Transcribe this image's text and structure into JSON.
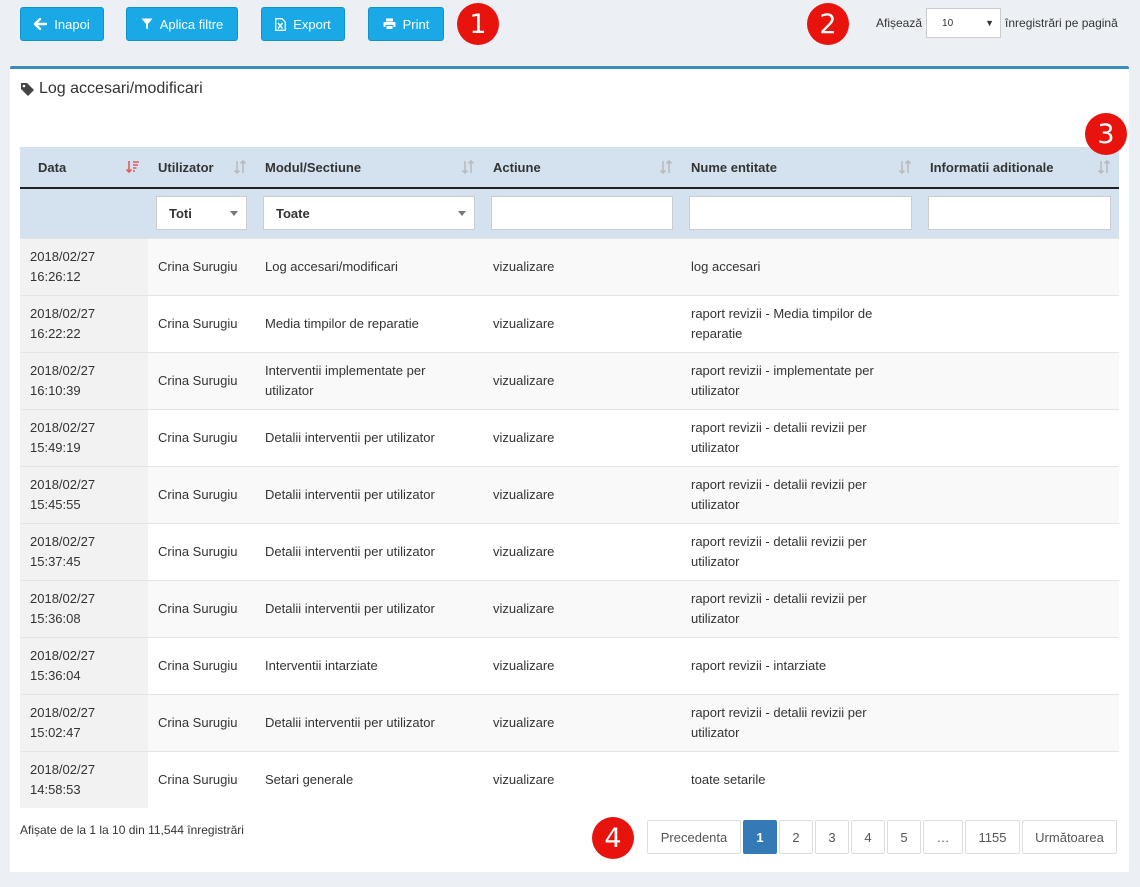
{
  "toolbar": {
    "back_label": "Inapoi",
    "filter_label": "Aplica filtre",
    "export_label": "Export",
    "print_label": "Print",
    "accent": "#18a9e6"
  },
  "markers": [
    "1",
    "2",
    "3",
    "4"
  ],
  "page_length": {
    "prefix": "Afișează",
    "value": "10",
    "suffix": "înregistrări pe pagină"
  },
  "panel": {
    "title": "Log accesari/modificari"
  },
  "table": {
    "headers": [
      "Data",
      "Utilizator",
      "Modul/Sectiune",
      "Actiune",
      "Nume entitate",
      "Informatii aditionale"
    ],
    "filters": {
      "user": "Toti",
      "module": "Toate"
    },
    "rows": [
      [
        "2018/02/27 16:26:12",
        "Crina Surugiu",
        "Log accesari/modificari",
        "vizualizare",
        "log accesari",
        ""
      ],
      [
        "2018/02/27 16:22:22",
        "Crina Surugiu",
        "Media timpilor de reparatie",
        "vizualizare",
        "raport revizii - Media timpilor de reparatie",
        ""
      ],
      [
        "2018/02/27 16:10:39",
        "Crina Surugiu",
        "Interventii implementate per utilizator",
        "vizualizare",
        "raport revizii - implementate per utilizator",
        ""
      ],
      [
        "2018/02/27 15:49:19",
        "Crina Surugiu",
        "Detalii interventii per utilizator",
        "vizualizare",
        "raport revizii - detalii revizii per utilizator",
        ""
      ],
      [
        "2018/02/27 15:45:55",
        "Crina Surugiu",
        "Detalii interventii per utilizator",
        "vizualizare",
        "raport revizii - detalii revizii per utilizator",
        ""
      ],
      [
        "2018/02/27 15:37:45",
        "Crina Surugiu",
        "Detalii interventii per utilizator",
        "vizualizare",
        "raport revizii - detalii revizii per utilizator",
        ""
      ],
      [
        "2018/02/27 15:36:08",
        "Crina Surugiu",
        "Detalii interventii per utilizator",
        "vizualizare",
        "raport revizii - detalii revizii per utilizator",
        ""
      ],
      [
        "2018/02/27 15:36:04",
        "Crina Surugiu",
        "Interventii intarziate",
        "vizualizare",
        "raport revizii - intarziate",
        ""
      ],
      [
        "2018/02/27 15:02:47",
        "Crina Surugiu",
        "Detalii interventii per utilizator",
        "vizualizare",
        "raport revizii - detalii revizii per utilizator",
        ""
      ],
      [
        "2018/02/27 14:58:53",
        "Crina Surugiu",
        "Setari generale",
        "vizualizare",
        "toate setarile",
        ""
      ]
    ]
  },
  "info_text": "Afișate de la 1 la 10 din 11,544 înregistrări",
  "pagination": {
    "prev": "Precedenta",
    "pages": [
      "1",
      "2",
      "3",
      "4",
      "5",
      "…",
      "1155"
    ],
    "next": "Următoarea",
    "active": "1"
  }
}
